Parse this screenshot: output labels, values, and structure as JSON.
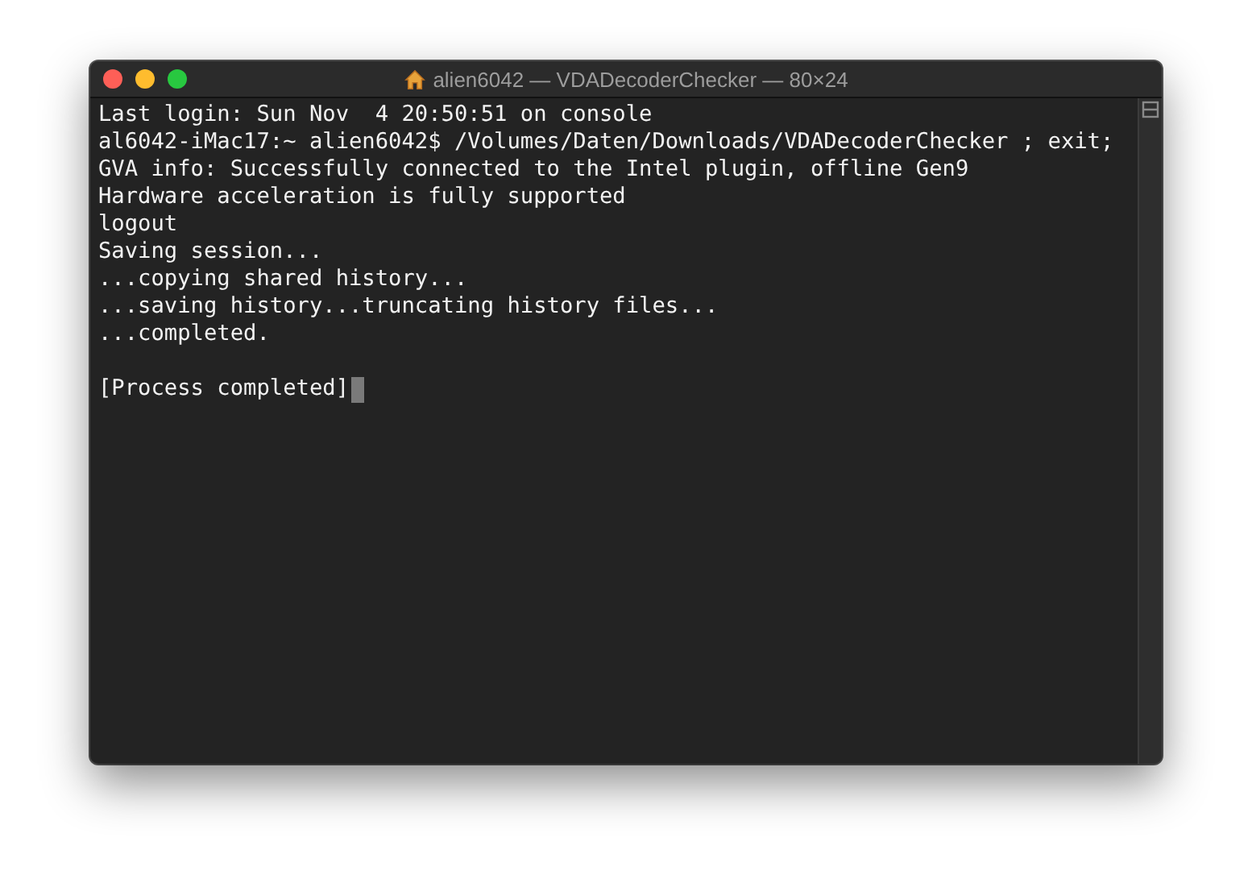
{
  "window": {
    "title": "alien6042 — VDADecoderChecker — 80×24"
  },
  "terminal": {
    "lines": [
      "Last login: Sun Nov  4 20:50:51 on console",
      "al6042-iMac17:~ alien6042$ /Volumes/Daten/Downloads/VDADecoderChecker ; exit;",
      "GVA info: Successfully connected to the Intel plugin, offline Gen9",
      "Hardware acceleration is fully supported",
      "logout",
      "Saving session...",
      "...copying shared history...",
      "...saving history...truncating history files...",
      "...completed."
    ],
    "status_line": "[Process completed]"
  }
}
